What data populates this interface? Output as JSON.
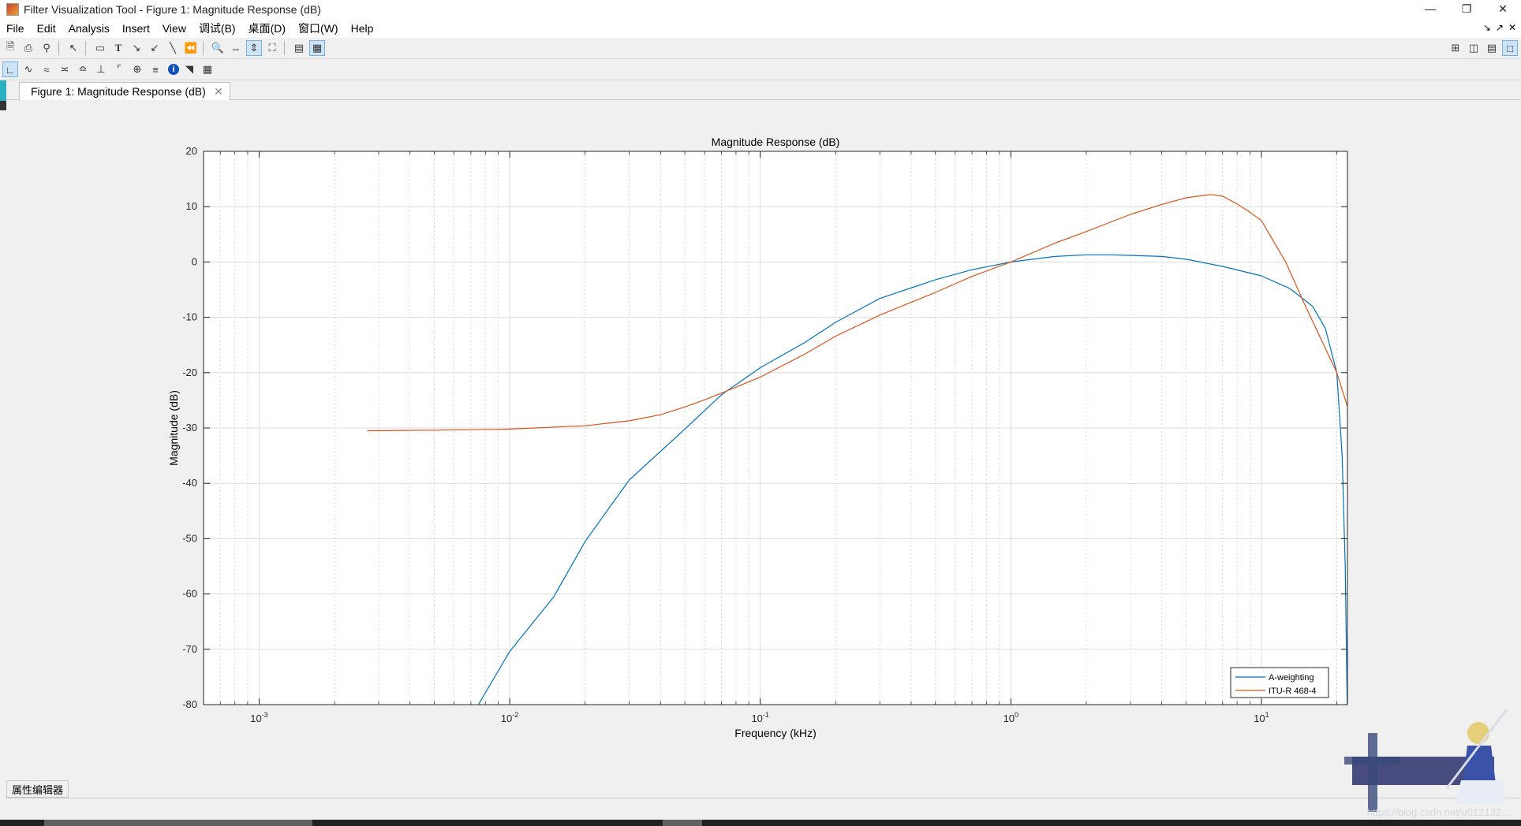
{
  "window": {
    "title": "Filter Visualization Tool - Figure 1: Magnitude Response (dB)"
  },
  "menu": [
    "File",
    "Edit",
    "Analysis",
    "Insert",
    "View",
    "调试(B)",
    "桌面(D)",
    "窗口(W)",
    "Help"
  ],
  "tab": {
    "label": "Figure 1: Magnitude Response (dB)"
  },
  "property_editor": "属性编辑器",
  "watermark_text": "https://blog.csdn.net/u012132...",
  "chart_data": {
    "type": "line",
    "title": "Magnitude Response (dB)",
    "xlabel": "Frequency (kHz)",
    "ylabel": "Magnitude (dB)",
    "xscale": "log",
    "xlim": [
      0.0006,
      22.05
    ],
    "ylim": [
      -80,
      20
    ],
    "yticks": [
      20,
      10,
      0,
      -10,
      -20,
      -30,
      -40,
      -50,
      -60,
      -70,
      -80
    ],
    "xticks": [
      {
        "value": 0.001,
        "base": "10",
        "exp": "-3"
      },
      {
        "value": 0.01,
        "base": "10",
        "exp": "-2"
      },
      {
        "value": 0.1,
        "base": "10",
        "exp": "-1"
      },
      {
        "value": 1,
        "base": "10",
        "exp": "0"
      },
      {
        "value": 10,
        "base": "10",
        "exp": "1"
      }
    ],
    "grid": true,
    "legend": "bottom-right",
    "series": [
      {
        "name": "A-weighting",
        "color": "#0072bd",
        "x": [
          0.0075,
          0.01,
          0.015,
          0.02,
          0.03,
          0.05,
          0.07,
          0.1,
          0.15,
          0.2,
          0.3,
          0.5,
          0.7,
          1.0,
          1.5,
          2.0,
          2.5,
          3.0,
          4.0,
          5.0,
          7.0,
          10.0,
          13.0,
          16.0,
          18.0,
          20.0,
          21.0,
          21.6,
          22.0
        ],
        "y": [
          -80,
          -70.4,
          -60.5,
          -50.5,
          -39.4,
          -30.2,
          -24.0,
          -19.1,
          -14.6,
          -10.9,
          -6.6,
          -3.2,
          -1.4,
          0.0,
          1.0,
          1.3,
          1.3,
          1.2,
          1.0,
          0.5,
          -0.8,
          -2.5,
          -4.8,
          -8.0,
          -12.0,
          -20.0,
          -35.0,
          -55.0,
          -80.0
        ]
      },
      {
        "name": "ITU-R 468-4",
        "color": "#d95319",
        "x": [
          0.0027,
          0.005,
          0.01,
          0.02,
          0.03,
          0.04,
          0.05,
          0.06,
          0.07,
          0.1,
          0.15,
          0.2,
          0.3,
          0.5,
          0.7,
          1.0,
          1.5,
          2.0,
          3.0,
          4.0,
          5.0,
          6.0,
          6.3,
          7.0,
          8.0,
          9.0,
          10.0,
          12.5,
          15.0,
          20.0,
          22.0
        ],
        "y": [
          -30.5,
          -30.4,
          -30.2,
          -29.6,
          -28.7,
          -27.6,
          -26.2,
          -24.9,
          -23.7,
          -20.8,
          -16.7,
          -13.4,
          -9.6,
          -5.5,
          -2.6,
          0.0,
          3.4,
          5.5,
          8.6,
          10.4,
          11.6,
          12.1,
          12.2,
          11.9,
          10.5,
          9.0,
          7.5,
          0.0,
          -8.0,
          -20.0,
          -26.0
        ]
      }
    ]
  }
}
